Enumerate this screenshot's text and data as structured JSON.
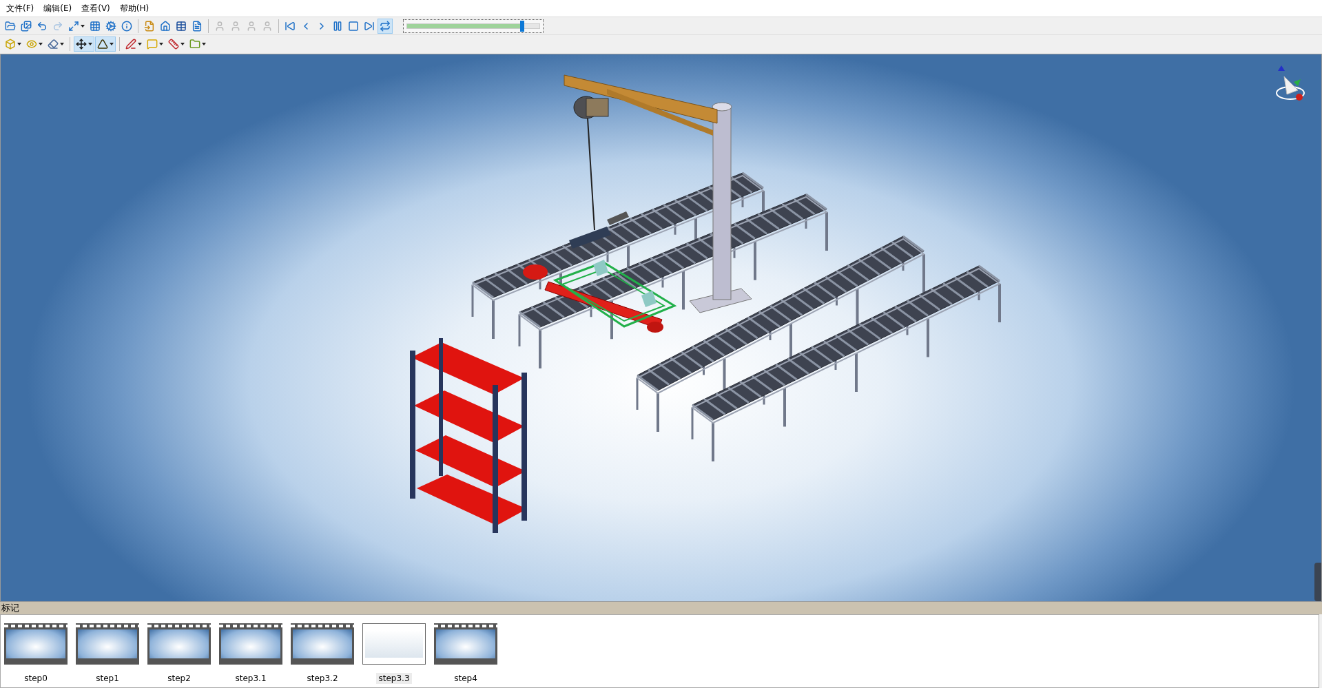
{
  "menu": [
    {
      "label": "文件(F)"
    },
    {
      "label": "编辑(E)"
    },
    {
      "label": "查看(V)"
    },
    {
      "label": "帮助(H)"
    }
  ],
  "toolbar_1": [
    {
      "kind": "open",
      "disabled": false,
      "pressed": false,
      "dropdown": false
    },
    {
      "kind": "images",
      "disabled": false,
      "pressed": false,
      "dropdown": false
    },
    {
      "kind": "undo",
      "disabled": false,
      "pressed": false,
      "dropdown": false
    },
    {
      "kind": "redo",
      "disabled": true,
      "pressed": false,
      "dropdown": false
    },
    {
      "kind": "fit",
      "disabled": false,
      "pressed": false,
      "dropdown": true
    },
    {
      "kind": "zoombox",
      "disabled": false,
      "pressed": false,
      "dropdown": false
    },
    {
      "kind": "gears",
      "disabled": false,
      "pressed": false,
      "dropdown": false
    },
    {
      "kind": "info",
      "disabled": false,
      "pressed": false,
      "dropdown": false
    },
    {
      "kind": "separator"
    },
    {
      "kind": "import",
      "disabled": false,
      "pressed": false,
      "dropdown": false
    },
    {
      "kind": "home",
      "disabled": false,
      "pressed": false,
      "dropdown": false
    },
    {
      "kind": "bom",
      "disabled": false,
      "pressed": false,
      "dropdown": false
    },
    {
      "kind": "doc",
      "disabled": false,
      "pressed": false,
      "dropdown": false
    },
    {
      "kind": "separator"
    },
    {
      "kind": "part",
      "disabled": true,
      "pressed": false,
      "dropdown": false
    },
    {
      "kind": "part",
      "disabled": true,
      "pressed": false,
      "dropdown": false
    },
    {
      "kind": "part",
      "disabled": true,
      "pressed": false,
      "dropdown": false
    },
    {
      "kind": "part",
      "disabled": true,
      "pressed": false,
      "dropdown": false
    },
    {
      "kind": "separator"
    },
    {
      "kind": "first",
      "disabled": false,
      "pressed": false,
      "dropdown": false
    },
    {
      "kind": "prev",
      "disabled": false,
      "pressed": false,
      "dropdown": false
    },
    {
      "kind": "play",
      "disabled": false,
      "pressed": false,
      "dropdown": false
    },
    {
      "kind": "pause",
      "disabled": false,
      "pressed": false,
      "dropdown": false
    },
    {
      "kind": "stop",
      "disabled": false,
      "pressed": false,
      "dropdown": false
    },
    {
      "kind": "last",
      "disabled": false,
      "pressed": false,
      "dropdown": false
    },
    {
      "kind": "loop",
      "disabled": false,
      "pressed": true,
      "dropdown": false
    }
  ],
  "timeline_slider": {
    "level": 0.87
  },
  "toolbar_2": [
    {
      "kind": "cube",
      "disabled": false,
      "pressed": false,
      "dropdown": true
    },
    {
      "kind": "eye",
      "disabled": false,
      "pressed": false,
      "dropdown": true
    },
    {
      "kind": "eraser",
      "disabled": false,
      "pressed": false,
      "dropdown": true
    },
    {
      "kind": "separator"
    },
    {
      "kind": "move",
      "disabled": false,
      "pressed": true,
      "dropdown": true
    },
    {
      "kind": "select",
      "disabled": false,
      "pressed": true,
      "dropdown": true
    },
    {
      "kind": "separator"
    },
    {
      "kind": "pen",
      "disabled": false,
      "pressed": false,
      "dropdown": true
    },
    {
      "kind": "note",
      "disabled": false,
      "pressed": false,
      "dropdown": true
    },
    {
      "kind": "measure",
      "disabled": false,
      "pressed": false,
      "dropdown": true
    },
    {
      "kind": "folder",
      "disabled": false,
      "pressed": false,
      "dropdown": true
    }
  ],
  "markers_panel": {
    "title": "标记",
    "items": [
      {
        "label": "step0",
        "selected": false
      },
      {
        "label": "step1",
        "selected": false
      },
      {
        "label": "step2",
        "selected": false
      },
      {
        "label": "step3.1",
        "selected": false
      },
      {
        "label": "step3.2",
        "selected": false
      },
      {
        "label": "step3.3",
        "selected": true
      },
      {
        "label": "step4",
        "selected": false
      }
    ]
  }
}
